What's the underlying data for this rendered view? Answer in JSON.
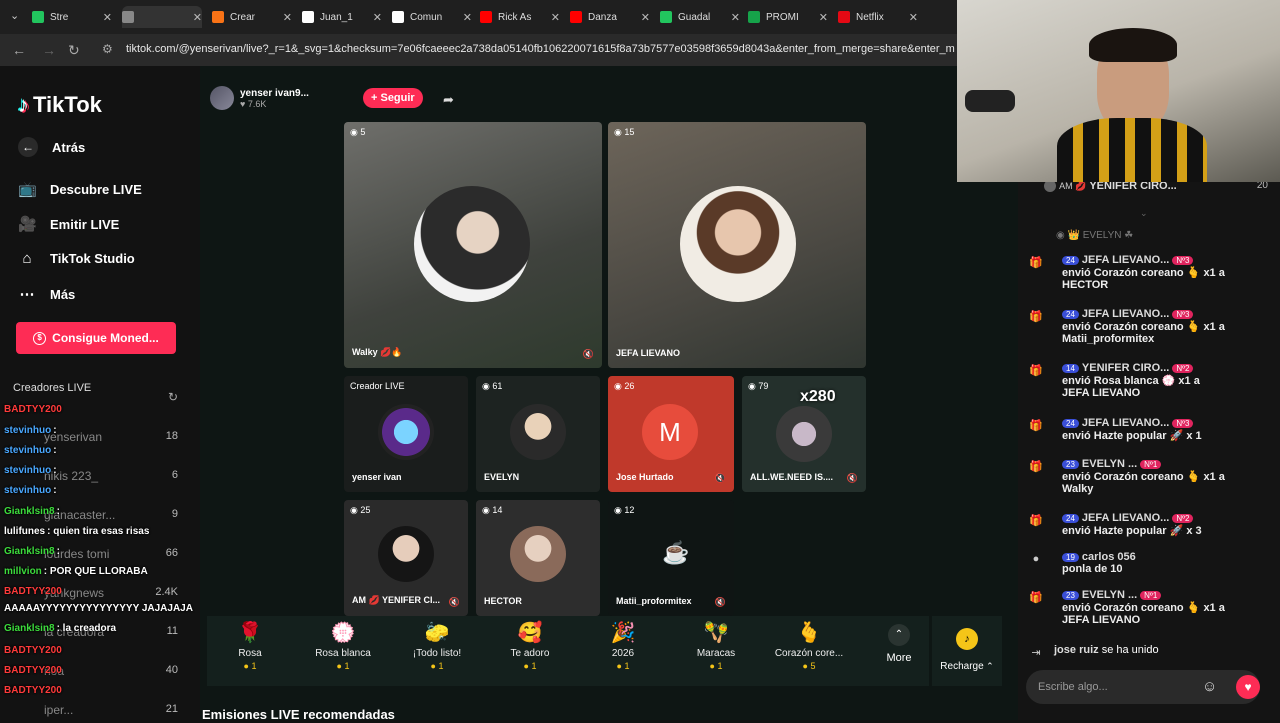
{
  "browser": {
    "tabs": [
      {
        "label": "Stre",
        "color": "#22c55e"
      },
      {
        "label": "",
        "color": "#888888"
      },
      {
        "label": "Crear",
        "color": "#f97316"
      },
      {
        "label": "Juan_1",
        "color": "#ffffff"
      },
      {
        "label": "Comun",
        "color": "#ffffff"
      },
      {
        "label": "Rick As",
        "color": "#ff0000"
      },
      {
        "label": "Danza",
        "color": "#ff0000"
      },
      {
        "label": "Guadal",
        "color": "#22c55e"
      },
      {
        "label": "PROMI",
        "color": "#16a34a"
      },
      {
        "label": "Netflix",
        "color": "#e50914"
      }
    ],
    "url": "tiktok.com/@yenserivan/live?_r=1&_svg=1&checksum=7e06fcaeeec2a738da05140fb106220071615f8a73b7577e03598f3659d8043a&enter_from_merge=share&enter_m"
  },
  "sidebar": {
    "logo": "TikTok",
    "back": "Atrás",
    "items": [
      "Descubre LIVE",
      "Emitir LIVE",
      "TikTok Studio",
      "Más"
    ],
    "coins_button": "Consigue Moned...",
    "creators_title": "Creadores LIVE",
    "creators": [
      {
        "name": "yenserivan",
        "count": "18"
      },
      {
        "name": "nikis 223_",
        "count": "6"
      },
      {
        "name": "gianacaster...",
        "count": "9"
      },
      {
        "name": "lourdes tomi",
        "count": "66"
      },
      {
        "name": "yankgnews",
        "count": "2.4K"
      },
      {
        "name": "la creadora",
        "count": "11"
      },
      {
        "name": "noa",
        "count": "40"
      },
      {
        "name": "iper...",
        "count": "21"
      }
    ]
  },
  "overlay_chat": [
    {
      "user": "BADTYY200",
      "text": "",
      "color": "#ff3b3b"
    },
    {
      "user": "stevinhuo",
      "text": ":",
      "color": "#4aa8ff"
    },
    {
      "user": "stevinhuo",
      "text": ":",
      "color": "#4aa8ff"
    },
    {
      "user": "stevinhuo",
      "text": ":",
      "color": "#4aa8ff"
    },
    {
      "user": "stevinhuo",
      "text": ":",
      "color": "#4aa8ff"
    },
    {
      "user": "Gianklsin8",
      "text": ":",
      "color": "#3ddc3d"
    },
    {
      "user": "lulifunes",
      "text": ": quien tira esas risas",
      "color": "#ffffff"
    },
    {
      "user": "Gianklsin8",
      "text": ":",
      "color": "#3ddc3d"
    },
    {
      "user": "millvion",
      "text": ": POR QUE LLORABA",
      "color": "#3ddc3d"
    },
    {
      "user": "BADTYY200",
      "text": "",
      "color": "#ff3b3b"
    },
    {
      "user": "AAAAAYYYYYYYYYYYYYYY JAJAJAJA",
      "text": "",
      "color": "#ffffff"
    },
    {
      "user": "Gianklsin8",
      "text": ": la creadora",
      "color": "#3ddc3d"
    },
    {
      "user": "BADTYY200",
      "text": "",
      "color": "#ff3b3b"
    },
    {
      "user": "BADTYY200",
      "text": "",
      "color": "#ff3b3b"
    },
    {
      "user": "BADTYY200",
      "text": "",
      "color": "#ff3b3b"
    }
  ],
  "live": {
    "host_name": "yenser ivan9...",
    "host_likes": "7.6K",
    "follow": "+ Seguir",
    "tiles": [
      {
        "num": "5",
        "name": "Walky"
      },
      {
        "num": "15",
        "name": "JEFA LIEVANO"
      },
      {
        "num": "",
        "name": "yenser ivan",
        "badge": "Creador LIVE"
      },
      {
        "num": "61",
        "name": "EVELYN"
      },
      {
        "num": "26",
        "name": "Jose Hurtado",
        "letter": "M"
      },
      {
        "num": "79",
        "name": "ALL.WE.NEED IS....",
        "multiplier": "x280"
      },
      {
        "num": "25",
        "name": "YENIFER CI..."
      },
      {
        "num": "14",
        "name": "HECTOR"
      },
      {
        "num": "12",
        "name": "Matii_proformitex"
      }
    ]
  },
  "gifts": [
    {
      "label": "Rosa",
      "price": "1",
      "icon": "🌹"
    },
    {
      "label": "Rosa blanca",
      "price": "1",
      "icon": "💮"
    },
    {
      "label": "¡Todo listo!",
      "price": "1",
      "icon": "🧽"
    },
    {
      "label": "Te adoro",
      "price": "1",
      "icon": "🥰"
    },
    {
      "label": "2026",
      "price": "1",
      "icon": "🎉"
    },
    {
      "label": "Maracas",
      "price": "1",
      "icon": "🪇"
    },
    {
      "label": "Corazón core...",
      "price": "5",
      "icon": "🫰"
    }
  ],
  "more": "More",
  "recharge": "Recharge",
  "recommended": "Emisiones LIVE recomendadas",
  "chat": {
    "top_user": "YENIFER CIRO...",
    "top_count": "20",
    "evelyn_line": "EVELYN",
    "messages": [
      {
        "lvl": "24",
        "user": "JEFA LIEVANO...",
        "rank": "Nº3",
        "text": "envió Corazón coreano 🫰 x1 a",
        "to": "HECTOR"
      },
      {
        "lvl": "24",
        "user": "JEFA LIEVANO...",
        "rank": "Nº3",
        "text": "envió Corazón coreano 🫰 x1 a",
        "to": "Matii_proformitex"
      },
      {
        "lvl": "14",
        "user": "YENIFER CIRO...",
        "rank": "Nº2",
        "text": "envió Rosa blanca 💮 x1 a",
        "to": "JEFA LIEVANO"
      },
      {
        "lvl": "24",
        "user": "JEFA LIEVANO...",
        "rank": "Nº3",
        "text": "envió Hazte popular 🚀 x 1",
        "to": ""
      },
      {
        "lvl": "23",
        "user": "EVELYN ...",
        "rank": "Nº1",
        "text": "envió Corazón coreano 🫰 x1 a",
        "to": "Walky"
      },
      {
        "lvl": "24",
        "user": "JEFA LIEVANO...",
        "rank": "Nº2",
        "text": "envió Hazte popular 🚀 x 3",
        "to": ""
      },
      {
        "lvl": "19",
        "user": "carlos 056",
        "rank": "",
        "text": "ponla de 10",
        "to": ""
      },
      {
        "lvl": "23",
        "user": "EVELYN ...",
        "rank": "Nº1",
        "text": "envió Corazón coreano 🫰 x1 a",
        "to": "JEFA LIEVANO"
      }
    ],
    "joined_user": "jose ruiz",
    "joined_text": "se ha unido",
    "input_placeholder": "Escribe algo..."
  }
}
